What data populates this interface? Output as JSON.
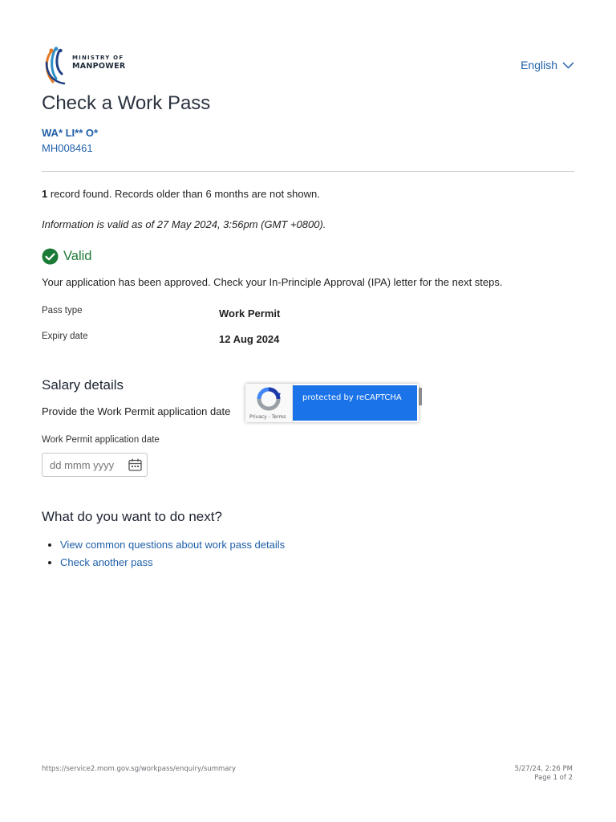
{
  "header": {
    "logo_line1": "MINISTRY OF",
    "logo_line2": "MANPOWER",
    "language": "English"
  },
  "page_title": "Check a Work Pass",
  "holder": {
    "masked_name": "WA* LI** O*",
    "reference": "MH008461"
  },
  "records": {
    "count": "1",
    "message": " record found. Records older than 6 months are not shown."
  },
  "validity_note": "Information is valid as of 27 May 2024, 3:56pm (GMT +0800).",
  "status": {
    "label": "Valid",
    "color": "#1b7a35",
    "icon": "check-circle-icon"
  },
  "approval_message": "Your application has been approved. Check your In-Principle Approval (IPA) letter for the next steps.",
  "details": [
    {
      "label": "Pass type",
      "value": "Work Permit"
    },
    {
      "label": "Expiry date",
      "value": "12 Aug 2024"
    }
  ],
  "salary": {
    "heading": "Salary details",
    "description": "Provide the Work Permit application date",
    "date_label": "Work Permit application date",
    "date_placeholder": "dd mmm yyyy"
  },
  "next_steps": {
    "heading": "What do you want to do next?",
    "links": [
      "View common questions about work pass details",
      "Check another pass"
    ]
  },
  "recaptcha": {
    "text": "protected by reCAPTCHA",
    "terms": "Privacy - Terms"
  },
  "footer": {
    "url": "https://service2.mom.gov.sg/workpass/enquiry/summary",
    "datetime": "5/27/24, 2:26 PM",
    "page": "Page 1 of 2"
  },
  "colors": {
    "link": "#1f5fa8",
    "recaptcha_blue": "#1a73e8"
  }
}
